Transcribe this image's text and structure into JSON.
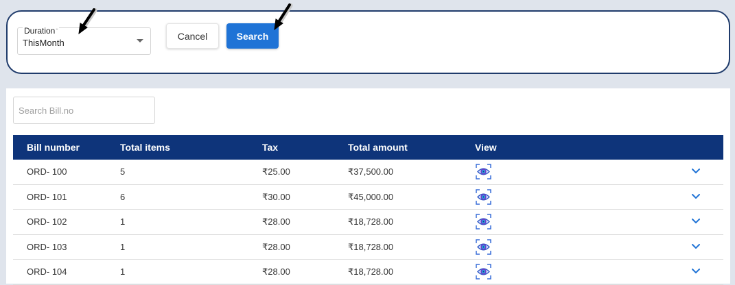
{
  "filter": {
    "duration_label": "Duration",
    "duration_required_mark": "*",
    "duration_value": "ThisMonth",
    "cancel_label": "Cancel",
    "search_label": "Search"
  },
  "bills": {
    "search_placeholder": "Search Bill.no",
    "columns": [
      "Bill number",
      "Total items",
      "Tax",
      "Total amount",
      "View"
    ],
    "rows": [
      {
        "bill": "ORD- 100",
        "items": "5",
        "tax": "₹25.00",
        "amount": "₹37,500.00"
      },
      {
        "bill": "ORD- 101",
        "items": "6",
        "tax": "₹30.00",
        "amount": "₹45,000.00"
      },
      {
        "bill": "ORD- 102",
        "items": "1",
        "tax": "₹28.00",
        "amount": "₹18,728.00"
      },
      {
        "bill": "ORD- 103",
        "items": "1",
        "tax": "₹28.00",
        "amount": "₹18,728.00"
      },
      {
        "bill": "ORD- 104",
        "items": "1",
        "tax": "₹28.00",
        "amount": "₹18,728.00"
      }
    ]
  },
  "colors": {
    "header_bg": "#0e347a",
    "primary_button": "#1f73d6",
    "card_border": "#1f3b6b"
  },
  "icons": {
    "view": "eye-scan-icon",
    "expand": "chevron-down-icon",
    "dropdown": "caret-down-icon",
    "annotation": "arrow-pointer-icon"
  }
}
